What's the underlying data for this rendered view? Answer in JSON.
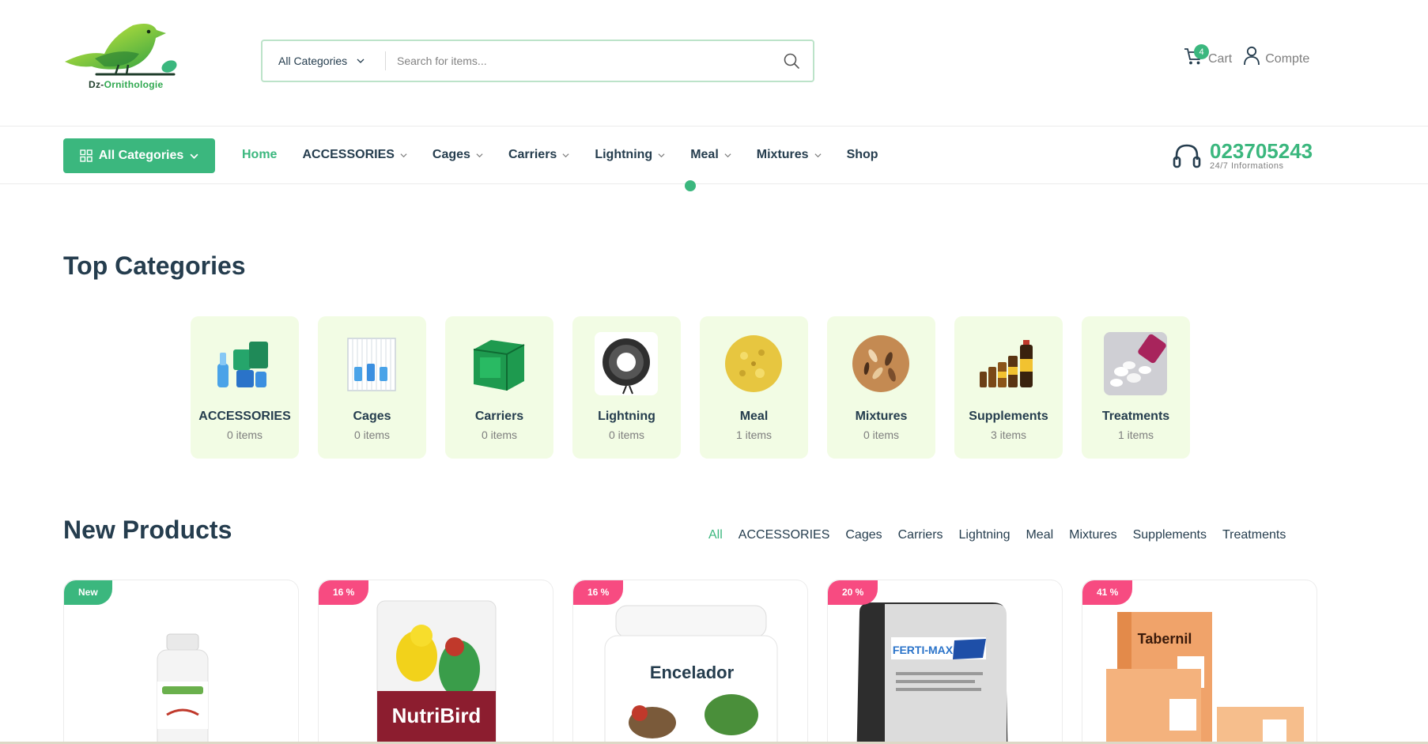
{
  "header": {
    "logo_text_prefix": "Dz-",
    "logo_text_accent": "Ornithologie",
    "search": {
      "category_label": "All Categories",
      "placeholder": "Search for items..."
    },
    "cart": {
      "label": "Cart",
      "count": "4"
    },
    "account": {
      "label": "Compte"
    }
  },
  "nav": {
    "all_categories_label": "All Categories",
    "items": [
      {
        "label": "Home",
        "has_dropdown": false
      },
      {
        "label": "ACCESSORIES",
        "has_dropdown": true
      },
      {
        "label": "Cages",
        "has_dropdown": true
      },
      {
        "label": "Carriers",
        "has_dropdown": true
      },
      {
        "label": "Lightning",
        "has_dropdown": true
      },
      {
        "label": "Meal",
        "has_dropdown": true
      },
      {
        "label": "Mixtures",
        "has_dropdown": true
      },
      {
        "label": "Shop",
        "has_dropdown": false
      }
    ],
    "hotline": {
      "number": "023705243",
      "subtitle": "24/7 Informations"
    }
  },
  "top_categories": {
    "title": "Top Categories",
    "items": [
      {
        "name": "ACCESSORIES",
        "count": "0 items",
        "icon": "accessories-icon"
      },
      {
        "name": "Cages",
        "count": "0 items",
        "icon": "cage-icon"
      },
      {
        "name": "Carriers",
        "count": "0 items",
        "icon": "carrier-icon"
      },
      {
        "name": "Lightning",
        "count": "0 items",
        "icon": "light-strip-icon"
      },
      {
        "name": "Meal",
        "count": "1 items",
        "icon": "meal-icon"
      },
      {
        "name": "Mixtures",
        "count": "0 items",
        "icon": "seed-mix-icon"
      },
      {
        "name": "Supplements",
        "count": "3 items",
        "icon": "bottles-icon"
      },
      {
        "name": "Treatments",
        "count": "1 items",
        "icon": "pills-icon"
      }
    ]
  },
  "new_products": {
    "title": "New Products",
    "tabs": [
      "All",
      "ACCESSORIES",
      "Cages",
      "Carriers",
      "Lightning",
      "Meal",
      "Mixtures",
      "Supplements",
      "Treatments"
    ],
    "active_tab": "All",
    "items": [
      {
        "badge": "New",
        "badge_type": "new",
        "image": "bottle-image"
      },
      {
        "badge": "16 %",
        "badge_type": "sale",
        "image": "nutribird-bag-image",
        "package_text": "NutriBird"
      },
      {
        "badge": "16 %",
        "badge_type": "sale",
        "image": "enceledor-jar-image",
        "package_text": "Encelador"
      },
      {
        "badge": "20 %",
        "badge_type": "sale",
        "image": "fertimax-bag-image",
        "package_text": "FERTI-MAX"
      },
      {
        "badge": "41 %",
        "badge_type": "sale",
        "image": "tabernil-box-image",
        "package_text": "Tabernil"
      }
    ]
  },
  "colors": {
    "brand": "#3bb77e",
    "heading": "#253d4e",
    "muted": "#7e7e7e",
    "category_bg": "#f2fce4",
    "sale_badge": "#f74b81"
  }
}
